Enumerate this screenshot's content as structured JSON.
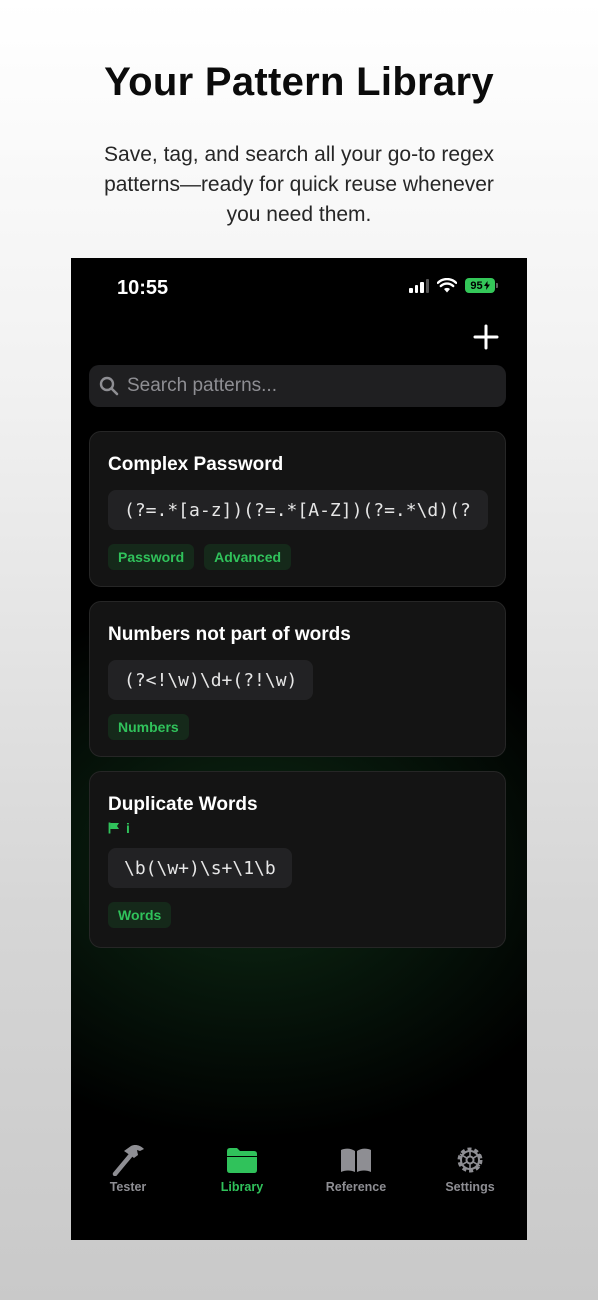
{
  "hero": {
    "title": "Your Pattern Library",
    "subtitle": "Save, tag, and search all your go-to regex patterns—ready for quick reuse whenever you need them."
  },
  "status_bar": {
    "time": "10:55",
    "battery": "95"
  },
  "search": {
    "placeholder": "Search patterns..."
  },
  "patterns": [
    {
      "title": "Complex Password",
      "regex": "(?=.*[a-z])(?=.*[A-Z])(?=.*\\d)(?",
      "tags": [
        "Password",
        "Advanced"
      ]
    },
    {
      "title": "Numbers not part of words",
      "regex": "(?<!\\w)\\d+(?!\\w)",
      "tags": [
        "Numbers"
      ]
    },
    {
      "title": "Duplicate Words",
      "flag_text": "i",
      "regex": "\\b(\\w+)\\s+\\1\\b",
      "tags": [
        "Words"
      ]
    }
  ],
  "tabs": [
    {
      "label": "Tester",
      "icon": "hammer-icon"
    },
    {
      "label": "Library",
      "icon": "folder-icon",
      "active": true
    },
    {
      "label": "Reference",
      "icon": "book-icon"
    },
    {
      "label": "Settings",
      "icon": "gear-icon"
    }
  ],
  "colors": {
    "accent": "#30c25b",
    "battery": "#34c759",
    "card": "#141414"
  }
}
